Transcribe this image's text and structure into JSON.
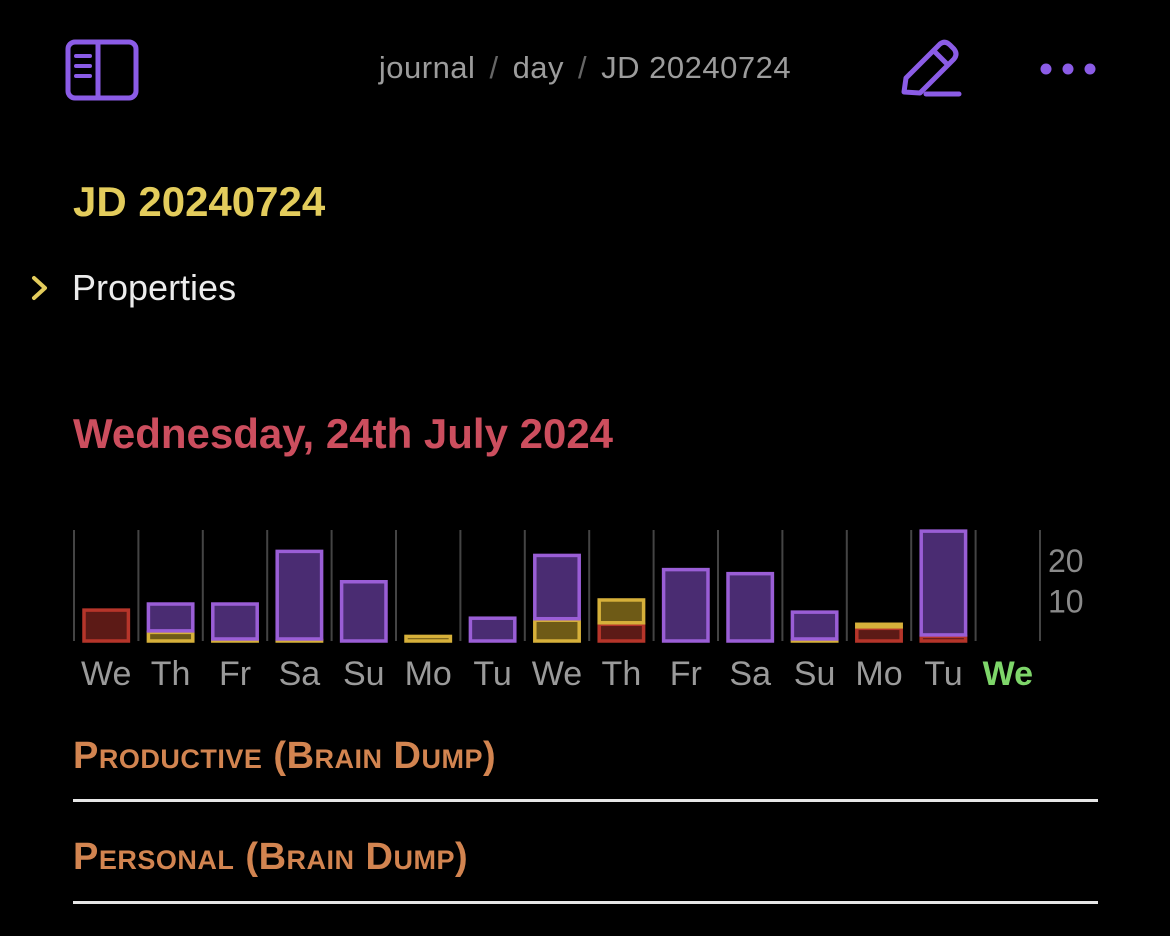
{
  "breadcrumb": {
    "part1": "journal",
    "sep": "/",
    "part2": "day",
    "part3": "JD 20240724"
  },
  "note": {
    "title": "JD 20240724"
  },
  "properties": {
    "label": "Properties"
  },
  "date_heading": "Wednesday, 24th July 2024",
  "colors": {
    "purple": "#9a5ed6",
    "yellow": "#d6b03a",
    "red": "#b6352a",
    "green": "#7ed66a",
    "title_yellow": "#e3cc5c",
    "date_red": "#cc4e5e",
    "section_orange": "#d28450"
  },
  "sections": {
    "productive": "Productive (Brain Dump)",
    "personal": "Personal (Brain Dump)"
  },
  "chart_data": {
    "type": "bar",
    "categories": [
      "We",
      "Th",
      "Fr",
      "Sa",
      "Su",
      "Mo",
      "Tu",
      "We",
      "Th",
      "Fr",
      "Sa",
      "Su",
      "Mo",
      "Tu",
      "We"
    ],
    "highlight_index": 14,
    "series": [
      {
        "color": "purple",
        "values": [
          0,
          7,
          9,
          22,
          15,
          0,
          6,
          16,
          0,
          18,
          17,
          7,
          0,
          26,
          0
        ]
      },
      {
        "color": "yellow",
        "values": [
          0,
          2.5,
          0.5,
          0.5,
          0,
          1.5,
          0,
          5.5,
          6,
          0,
          0,
          0.5,
          1,
          0,
          0
        ]
      },
      {
        "color": "red",
        "values": [
          8,
          0,
          0,
          0,
          0,
          0,
          0,
          0,
          4.5,
          0,
          0,
          0,
          3.5,
          1.5,
          0
        ]
      }
    ],
    "y_ticks": [
      "20",
      "10"
    ],
    "ylim": [
      0,
      27
    ],
    "grid": true
  }
}
